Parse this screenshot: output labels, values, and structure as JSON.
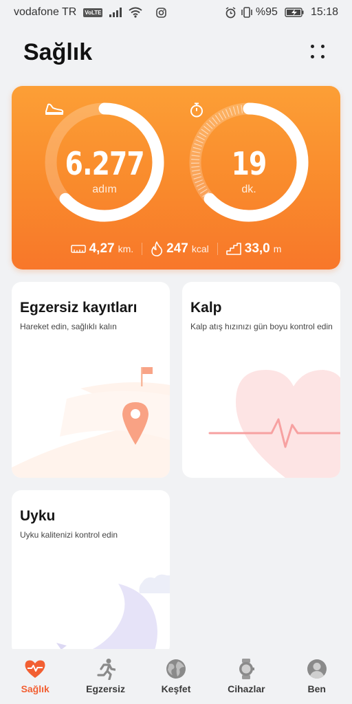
{
  "status_bar": {
    "carrier": "vodafone TR",
    "volte": "VoLTE",
    "battery": "%95",
    "time": "15:18"
  },
  "header": {
    "title": "Sağlık"
  },
  "activity": {
    "steps": {
      "value": "6.277",
      "unit": "adım",
      "progress": 0.63
    },
    "time": {
      "value": "19",
      "unit": "dk.",
      "progress": 0.63
    },
    "stats": [
      {
        "icon": "ruler-icon",
        "value": "4,27",
        "unit": "km."
      },
      {
        "icon": "flame-icon",
        "value": "247",
        "unit": "kcal"
      },
      {
        "icon": "stairs-icon",
        "value": "33,0",
        "unit": "m"
      }
    ],
    "colors": {
      "card_top": "#fc9f36",
      "card_bottom": "#f8772a"
    }
  },
  "tiles": {
    "exercise": {
      "title": "Egzersiz kayıtları",
      "subtitle": "Hareket edin, sağlıklı kalın"
    },
    "heart": {
      "title": "Kalp",
      "subtitle": "Kalp atış hızınızı gün boyu kontrol edin"
    },
    "sleep": {
      "title": "Uyku",
      "subtitle": "Uyku kalitenizi kontrol edin"
    }
  },
  "bottom_nav": {
    "items": [
      {
        "label": "Sağlık",
        "icon": "heart-pulse-icon",
        "active": true
      },
      {
        "label": "Egzersiz",
        "icon": "runner-icon",
        "active": false
      },
      {
        "label": "Keşfet",
        "icon": "globe-icon",
        "active": false
      },
      {
        "label": "Cihazlar",
        "icon": "watch-icon",
        "active": false
      },
      {
        "label": "Ben",
        "icon": "user-icon",
        "active": false
      }
    ],
    "active_color": "#f25f32"
  }
}
